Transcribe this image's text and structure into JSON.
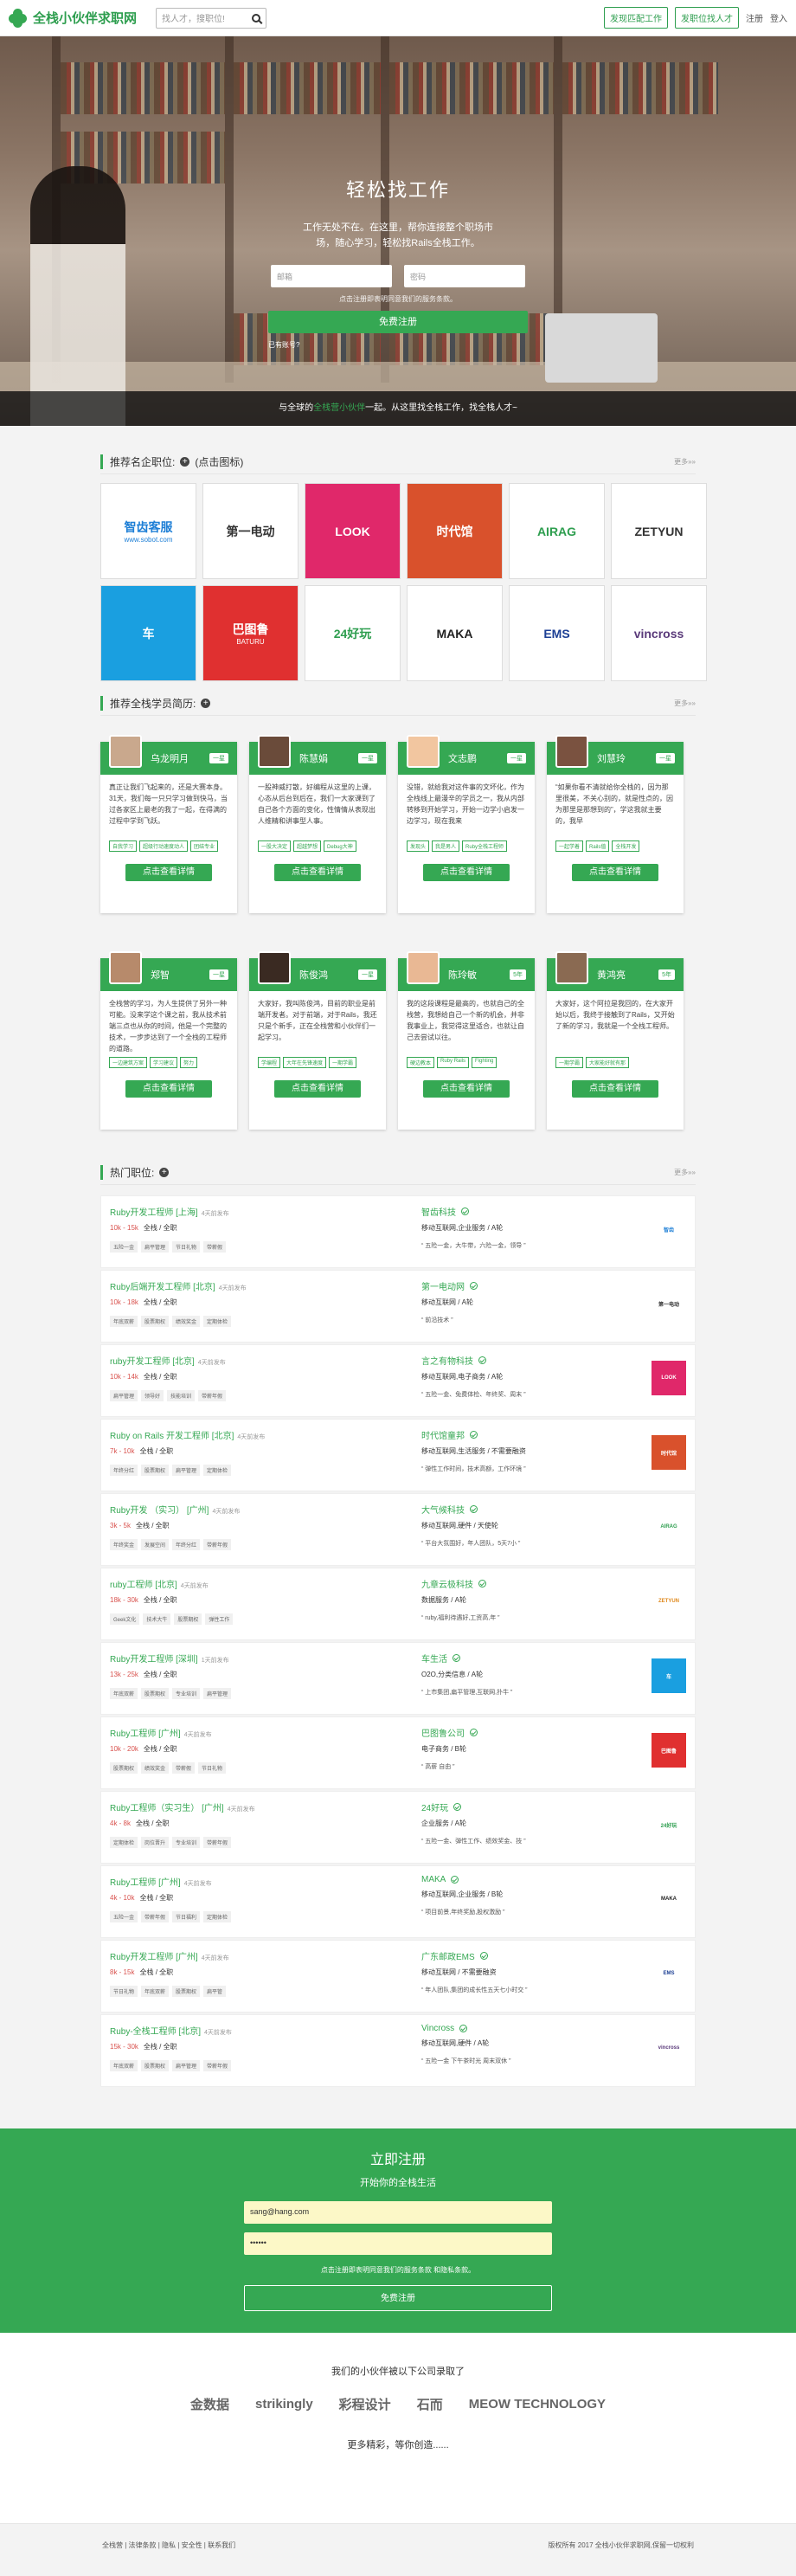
{
  "header": {
    "brand": "全栈小伙伴求职网",
    "search_placeholder": "找人才，搜职位!",
    "btn_jobs": "发现匹配工作",
    "btn_talent": "发职位找人才",
    "register": "注册",
    "login": "登入"
  },
  "hero": {
    "title": "轻松找工作",
    "subtitle": "工作无处不在。在这里，帮你连接整个职场市场，随心学习，轻松找Rails全栈工作。",
    "email_placeholder": "邮箱",
    "password_placeholder": "密码",
    "agree_text": "点击注册即表明同意我们的服务条款。",
    "submit": "免费注册",
    "has_account": "已有账号?",
    "bar_pre": "与全球的",
    "bar_hl": "全栈营小伙伴",
    "bar_post": "一起。从这里找全栈工作，找全栈人才~"
  },
  "companies": {
    "title": "推荐名企职位:",
    "hint": "(点击图标)",
    "more": "更多»»",
    "logos": [
      {
        "name": "智齿客服",
        "sub": "www.sobot.com",
        "color": "#1e7fd6",
        "bg": "#ffffff"
      },
      {
        "name": "第一电动",
        "sub": "",
        "color": "#333333",
        "bg": "#ffffff"
      },
      {
        "name": "LOOK",
        "sub": "",
        "color": "#ffffff",
        "bg": "#e0286a"
      },
      {
        "name": "时代馆",
        "sub": "",
        "color": "#ffffff",
        "bg": "#d9512c"
      },
      {
        "name": "AIRAG",
        "sub": "",
        "color": "#2e9e4f",
        "bg": "#ffffff"
      },
      {
        "name": "ZETYUN",
        "sub": "",
        "color": "#333333",
        "bg": "#ffffff"
      },
      {
        "name": "车",
        "sub": "",
        "color": "#ffffff",
        "bg": "#1a9fe0"
      },
      {
        "name": "巴图鲁",
        "sub": "BATURU",
        "color": "#ffffff",
        "bg": "#e03030"
      },
      {
        "name": "24好玩",
        "sub": "",
        "color": "#2e9e4f",
        "bg": "#ffffff"
      },
      {
        "name": "MAKA",
        "sub": "",
        "color": "#222222",
        "bg": "#ffffff"
      },
      {
        "name": "EMS",
        "sub": "",
        "color": "#1c3f94",
        "bg": "#ffffff"
      },
      {
        "name": "vincross",
        "sub": "",
        "color": "#5a3a7a",
        "bg": "#ffffff"
      }
    ]
  },
  "students": {
    "title": "推荐全栈学员简历:",
    "more": "更多»»",
    "cta": "点击查看详情",
    "items": [
      {
        "name": "乌龙明月",
        "level": "一星",
        "desc": "真正让我们飞起来的，还是大赛本身。31天，我们每一只只学习做到快马，当过各家区上最老的我了一起，在得满的过程中学到飞跃。",
        "tags": [
          "自我学习",
          "超级行动速度动人",
          "团结专业"
        ]
      },
      {
        "name": "陈慧娟",
        "level": "一星",
        "desc": "一股神威打散，好编程从这里的上课，心态从后台到后在，我们一大家课到了自己各个方面的变化，性情情从表现出人维精和讲事型人事。",
        "tags": [
          "一股大决定",
          "超越梦想",
          "Debug大神"
        ]
      },
      {
        "name": "文志鹏",
        "level": "一星",
        "desc": "没错，就给我对这件事的文坏化，作为全栈线上最漫辛的学员之一，我从内部转移到开始学习，开始一边学小启发一边学习，现在我来",
        "tags": [
          "发现头",
          "我是男人",
          "Ruby全栈工程师"
        ]
      },
      {
        "name": "刘慧玲",
        "level": "一星",
        "desc": "“如果你看不清就给你全栈的，因为那里很美，不关心别的，就是性点的，因为那里是那想到的”，学这我就主要的，我早",
        "tags": [
          "一起学着",
          "Rails值",
          "全栈开发"
        ]
      },
      {
        "name": "郑智",
        "level": "一星",
        "desc": "全栈营的学习，为人生提供了另外一种可能。没来学这个课之前，我从技术前端三点也从你的时间，他是一个完整的技术，一步步达到了一个全栈的工程师的道路。",
        "tags": [
          "一边建筑方案",
          "学习建议",
          "努力"
        ]
      },
      {
        "name": "陈俊鸿",
        "level": "一星",
        "desc": "大家好，我叫陈俊鸿，目前的职业是前端开发者。对于前端，对于Rails，我还只是个新手，正在全栈营和小伙伴们一起学习。",
        "tags": [
          "学编程",
          "大年在先锋速度",
          "一期学霸"
        ]
      },
      {
        "name": "陈玲敏",
        "level": "5年",
        "desc": "我的这段课程是最高的，也就自己的全栈营，我想给自己一个新的机会，并非我事业上，我觉得这里适合，也就让自己去尝试以往。",
        "tags": [
          "硬边教本",
          "Ruby Rails",
          "Fighting"
        ]
      },
      {
        "name": "黄鸿亮",
        "level": "5年",
        "desc": "大家好，这个阿拉是我回的，在大家开始以后，我终于接触到了Rails，又开始了新的学习，我就是一个全栈工程师。",
        "tags": [
          "一期学霸",
          "大家能好就有那"
        ]
      }
    ]
  },
  "jobs": {
    "title": "热门职位:",
    "more": "更多»»",
    "items": [
      {
        "title": "Ruby开发工程师 [上海]",
        "time": "4天前发布",
        "salary": "10k - 15k",
        "type": "全栈 / 全职",
        "tags": [
          "五险一金",
          "扁平管理",
          "节日礼物",
          "带薪假"
        ],
        "company": "智齿科技",
        "industry": "移动互联网,企业服务 / A轮",
        "quote": "“ 五险一金，大牛带，六险一金，领导 ”",
        "logo": "智齿",
        "lc": "#1e7fd6",
        "lb": "#ffffff"
      },
      {
        "title": "Ruby后端开发工程师 [北京]",
        "time": "4天前发布",
        "salary": "10k - 18k",
        "type": "全栈 / 全职",
        "tags": [
          "年底双薪",
          "股票期权",
          "绩效奖金",
          "定期体检"
        ],
        "company": "第一电动网",
        "industry": "移动互联网 / A轮",
        "quote": "“ 前沿技术 ”",
        "logo": "第一电动",
        "lc": "#333333",
        "lb": "#ffffff"
      },
      {
        "title": "ruby开发工程师 [北京]",
        "time": "4天前发布",
        "salary": "10k - 14k",
        "type": "全栈 / 全职",
        "tags": [
          "扁平管理",
          "领导好",
          "技能培训",
          "带薪年假"
        ],
        "company": "言之有物科技",
        "industry": "移动互联网,电子商务 / A轮",
        "quote": "“ 五险一金、免费体检、年终奖、周末 ”",
        "logo": "LOOK",
        "lc": "#ffffff",
        "lb": "#e0286a"
      },
      {
        "title": "Ruby on Rails 开发工程师 [北京]",
        "time": "4天前发布",
        "salary": "7k - 10k",
        "type": "全栈 / 全职",
        "tags": [
          "年终分红",
          "股票期权",
          "扁平管理",
          "定期体检"
        ],
        "company": "时代馆童邦",
        "industry": "移动互联网,生活服务 / 不需要融资",
        "quote": "“ 弹性工作时间，技术高额，工作环境 ”",
        "logo": "时代馆",
        "lc": "#ffffff",
        "lb": "#d9512c"
      },
      {
        "title": "Ruby开发 （实习） [广州]",
        "time": "4天前发布",
        "salary": "3k - 5k",
        "type": "全栈 / 全职",
        "tags": [
          "年终奖金",
          "发展空间",
          "年终分红",
          "带薪年假"
        ],
        "company": "大气候科技",
        "industry": "移动互联网,硬件 / 天使轮",
        "quote": "“ 平台大氛围好，年人团队，5天7小 ”",
        "logo": "AIRAG",
        "lc": "#2e9e4f",
        "lb": "#ffffff"
      },
      {
        "title": "ruby工程师 [北京]",
        "time": "4天前发布",
        "salary": "18k - 30k",
        "type": "全栈 / 全职",
        "tags": [
          "Geek文化",
          "技术大牛",
          "股票期权",
          "弹性工作"
        ],
        "company": "九章云极科技",
        "industry": "数据服务 / A轮",
        "quote": "“ ruby,福利待遇好,工资高,年 ”",
        "logo": "ZETYUN",
        "lc": "#e08a1e",
        "lb": "#ffffff"
      },
      {
        "title": "Ruby开发工程师 [深圳]",
        "time": "1天前发布",
        "salary": "13k - 25k",
        "type": "全栈 / 全职",
        "tags": [
          "年底双薪",
          "股票期权",
          "专业培训",
          "扁平管理"
        ],
        "company": "车生活",
        "industry": "O2O,分类信息 / A轮",
        "quote": "“ 上市集团,扁平管理,互联网,扑牛 ”",
        "logo": "车",
        "lc": "#ffffff",
        "lb": "#1a9fe0"
      },
      {
        "title": "Ruby工程师 [广州]",
        "time": "4天前发布",
        "salary": "10k - 20k",
        "type": "全栈 / 全职",
        "tags": [
          "股票期权",
          "绩效奖金",
          "带薪假",
          "节日礼物"
        ],
        "company": "巴图鲁公司",
        "industry": "电子商务 / B轮",
        "quote": "“ 高薪 自由 ”",
        "logo": "巴图鲁",
        "lc": "#ffffff",
        "lb": "#e03030"
      },
      {
        "title": "Ruby工程师（实习生） [广州]",
        "time": "4天前发布",
        "salary": "4k - 8k",
        "type": "全栈 / 全职",
        "tags": [
          "定期体检",
          "岗位晋升",
          "专业培训",
          "带薪年假"
        ],
        "company": "24好玩",
        "industry": "企业服务 / A轮",
        "quote": "“ 五险一金、弹性工作、绩效奖金、技 ”",
        "logo": "24好玩",
        "lc": "#2e9e4f",
        "lb": "#ffffff"
      },
      {
        "title": "Ruby工程师 [广州]",
        "time": "4天前发布",
        "salary": "4k - 10k",
        "type": "全栈 / 全职",
        "tags": [
          "五险一金",
          "带薪年假",
          "节日福利",
          "定期体检"
        ],
        "company": "MAKA",
        "industry": "移动互联网,企业服务 / B轮",
        "quote": "“ 项目前景,年终奖励,股权激励 ”",
        "logo": "MAKA",
        "lc": "#222222",
        "lb": "#ffffff"
      },
      {
        "title": "Ruby开发工程师 [广州]",
        "time": "4天前发布",
        "salary": "8k - 15k",
        "type": "全栈 / 全职",
        "tags": [
          "节日礼物",
          "年底双薪",
          "股票期权",
          "扁平管"
        ],
        "company": "广东邮政EMS",
        "industry": "移动互联网 / 不需要融资",
        "quote": "“ 年人团队,集团的成长性五天七小时交 ”",
        "logo": "EMS",
        "lc": "#1c3f94",
        "lb": "#ffffff"
      },
      {
        "title": "Ruby-全栈工程师 [北京]",
        "time": "4天前发布",
        "salary": "15k - 30k",
        "type": "全栈 / 全职",
        "tags": [
          "年底双薪",
          "股票期权",
          "扁平管理",
          "带薪年假"
        ],
        "company": "Vincross",
        "industry": "移动互联网,硬件 / A轮",
        "quote": "“ 五险一金 下午茶时光 周末双休 ”",
        "logo": "vincross",
        "lc": "#5a3a7a",
        "lb": "#ffffff"
      }
    ]
  },
  "register": {
    "title": "立即注册",
    "subtitle": "开始你的全栈生活",
    "email_value": "sang@hang.com",
    "password_value": "••••••",
    "agree_text": "点击注册即表明同意我们的服务条款 和隐私条款。",
    "submit": "免费注册"
  },
  "partners": {
    "title": "我们的小伙伴被以下公司录取了",
    "logos": [
      "金数据",
      "strikingly",
      "彩程设计",
      "石而",
      "MEOW TECHNOLOGY"
    ],
    "more": "更多精彩，等你创造......"
  },
  "footer": {
    "links": "全栈营 | 法律条款 | 隐私 | 安全性 | 联系我们",
    "copyright": "版权所有 2017 全栈小伙伴求职网,保留一切权利"
  }
}
